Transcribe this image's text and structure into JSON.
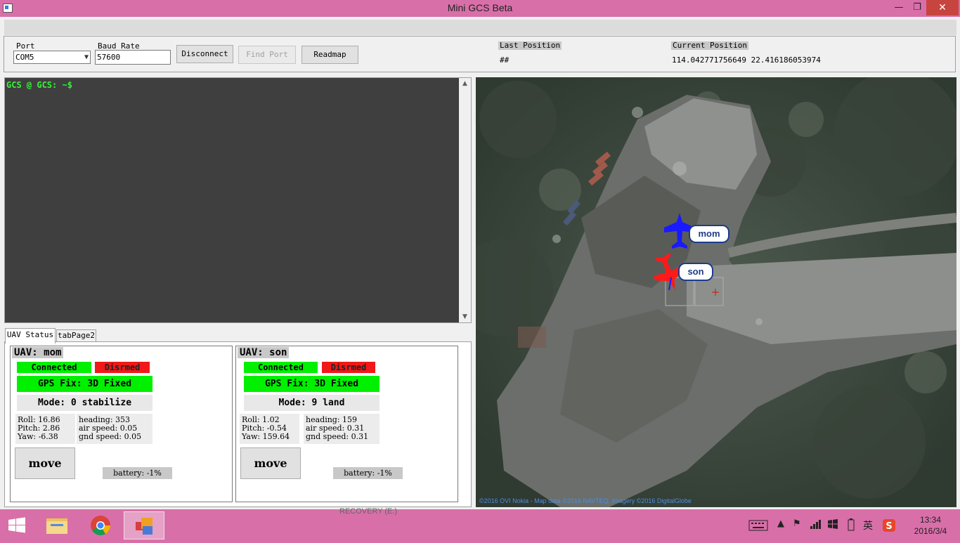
{
  "window": {
    "title": "Mini GCS Beta",
    "minimize": "—",
    "maximize": "❐",
    "close": "✕"
  },
  "connection": {
    "port_label": "Port",
    "port_value": "COM5",
    "baud_label": "Baud Rate",
    "baud_value": "57600",
    "disconnect_label": "Disconnect",
    "find_port_label": "Find Port",
    "readmap_label": "Readmap"
  },
  "position": {
    "last_label": "Last Position",
    "last_value": "##",
    "current_label": "Current Position",
    "current_value": "114.042771756649  22.416186053974"
  },
  "console": {
    "prompt": "GCS @ GCS: ~$"
  },
  "tabs": [
    {
      "label": "UAV Status"
    },
    {
      "label": "tabPage2"
    }
  ],
  "uavs": [
    {
      "title": "UAV: mom",
      "connection": "Connected",
      "arm": "Disrmed",
      "gps": "GPS Fix: 3D Fixed",
      "mode": "Mode: 0 stabilize",
      "roll": "Roll: 16.86",
      "pitch": "Pitch: 2.86",
      "yaw": "Yaw: -6.38",
      "heading": "heading: 353",
      "air_speed": "air speed: 0.05",
      "gnd_speed": "gnd speed: 0.05",
      "move": "move",
      "battery": "battery: -1%"
    },
    {
      "title": "UAV: son",
      "connection": "Connected",
      "arm": "Disrmed",
      "gps": "GPS Fix: 3D Fixed",
      "mode": "Mode: 9 land",
      "roll": "Roll: 1.02",
      "pitch": "Pitch: -0.54",
      "yaw": "Yaw: 159.64",
      "heading": "heading: 159",
      "air_speed": "air speed: 0.31",
      "gnd_speed": "gnd speed: 0.31",
      "move": "move",
      "battery": "battery: -1%"
    }
  ],
  "map": {
    "markers": [
      {
        "label": "mom",
        "color": "#1a1aff"
      },
      {
        "label": "son",
        "color": "#ff1a1a"
      }
    ],
    "copyright": "©2016 OVI Nokia - Map data ©2016 NAVTEQ, Imagery ©2016 DigitalGlobe"
  },
  "taskbar": {
    "drive_label": "RECOVERY (E:)",
    "ime": "英",
    "time": "13:34",
    "date": "2016/3/4"
  },
  "colors": {
    "status_green": "#00f000",
    "status_red": "#f01818",
    "console_bg": "#3f3f3f",
    "prompt_green": "#3cf03c"
  }
}
